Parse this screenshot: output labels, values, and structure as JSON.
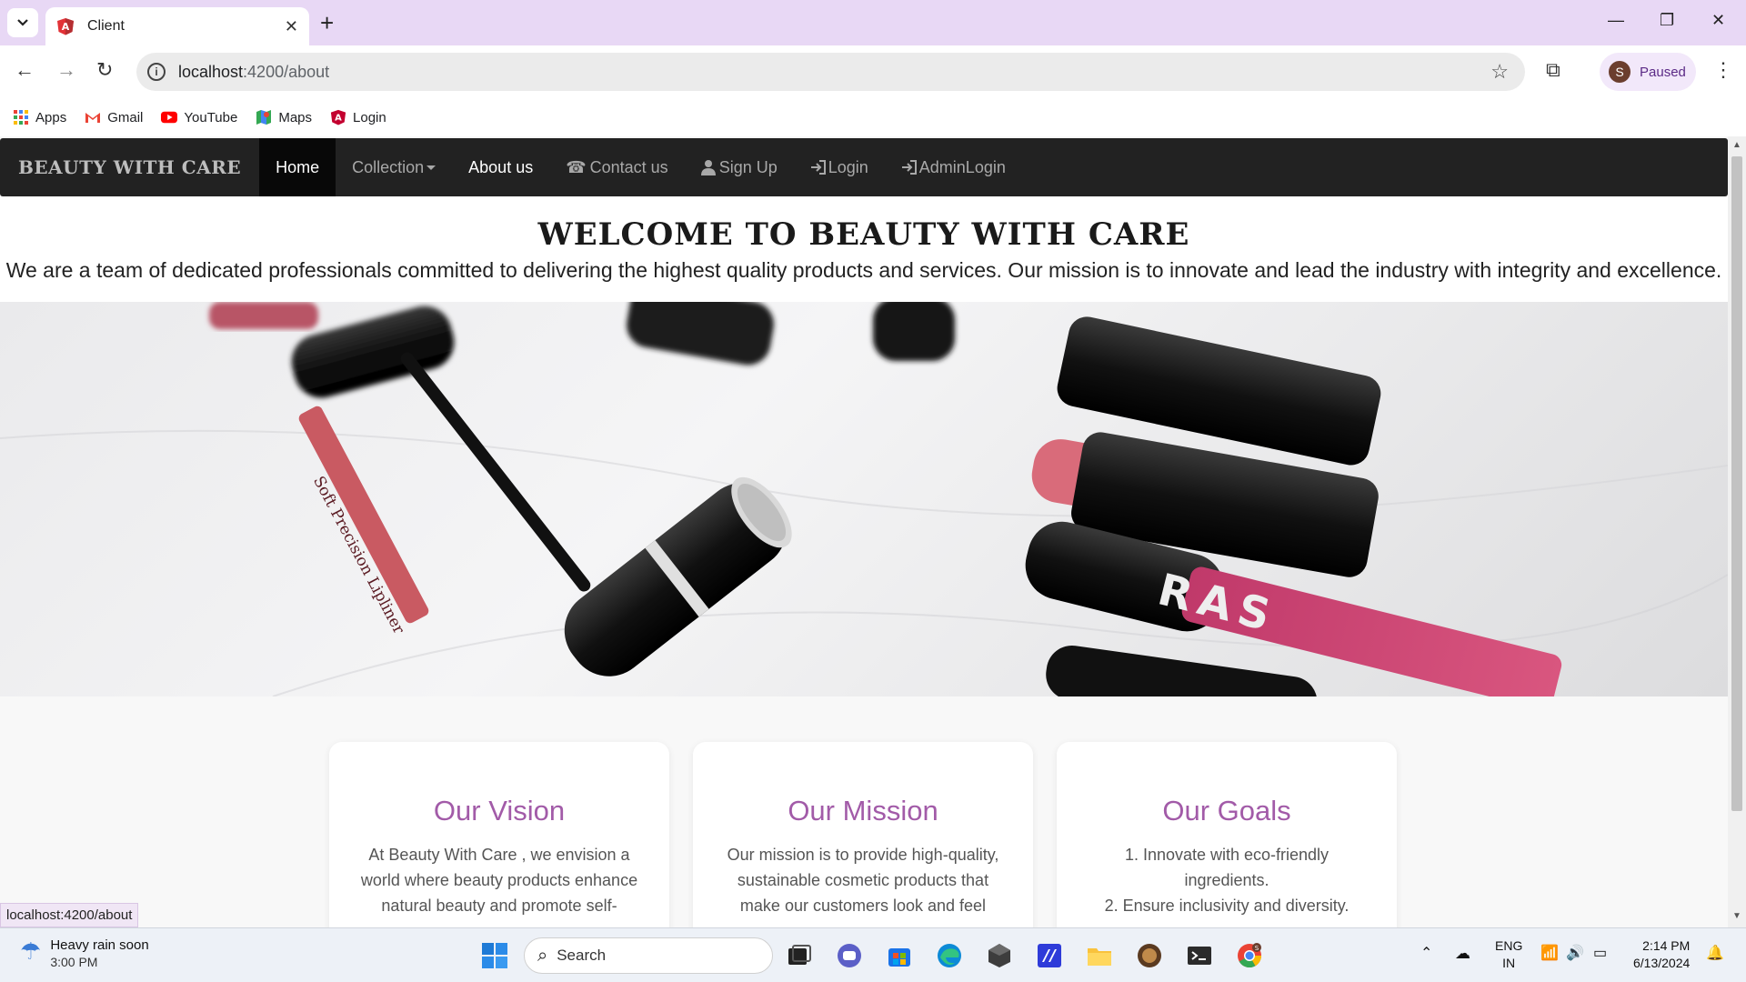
{
  "browser": {
    "tab_title": "Client",
    "url_host": "localhost",
    "url_path": ":4200/about",
    "profile_initial": "S",
    "profile_status": "Paused",
    "bookmarks": [
      {
        "label": "Apps",
        "icon": "apps-grid-icon"
      },
      {
        "label": "Gmail",
        "icon": "gmail-icon"
      },
      {
        "label": "YouTube",
        "icon": "youtube-icon"
      },
      {
        "label": "Maps",
        "icon": "maps-icon"
      },
      {
        "label": "Login",
        "icon": "angular-icon"
      }
    ]
  },
  "site": {
    "brand": "BEAUTY WITH CARE",
    "nav": {
      "home": "Home",
      "collection": "Collection",
      "about": "About us",
      "contact": "Contact us",
      "signup": "Sign Up",
      "login": "Login",
      "admin_login": "AdminLogin"
    },
    "hero_title": "WELCOME TO BEAUTY WITH CARE",
    "hero_text": "We are a team of dedicated professionals committed to delivering the highest quality products and services. Our mission is to innovate and lead the industry with integrity and excellence.",
    "banner_text": "Soft Precision Lipliner",
    "banner_brand": "RAS",
    "cards": [
      {
        "title": "Our Vision",
        "line1": "At Beauty With Care , we envision a",
        "line2": "world where beauty products enhance",
        "line3": "natural beauty and promote self-"
      },
      {
        "title": "Our Mission",
        "line1": "Our mission is to provide high-quality,",
        "line2": "sustainable cosmetic products that",
        "line3": "make our customers look and feel"
      },
      {
        "title": "Our Goals",
        "line1": "1. Innovate with eco-friendly",
        "line2": "ingredients.",
        "line3": "2. Ensure inclusivity and diversity."
      }
    ],
    "status_url": "localhost:4200/about"
  },
  "taskbar": {
    "weather_title": "Heavy rain soon",
    "weather_time": "3:00 PM",
    "search_placeholder": "Search",
    "lang_top": "ENG",
    "lang_bottom": "IN",
    "time": "2:14 PM",
    "date": "6/13/2024",
    "chrome_badge": "S"
  },
  "colors": {
    "accent_purple": "#a25ba8",
    "navbar_bg": "#222222",
    "tabstrip_bg": "#e8d8f5"
  }
}
